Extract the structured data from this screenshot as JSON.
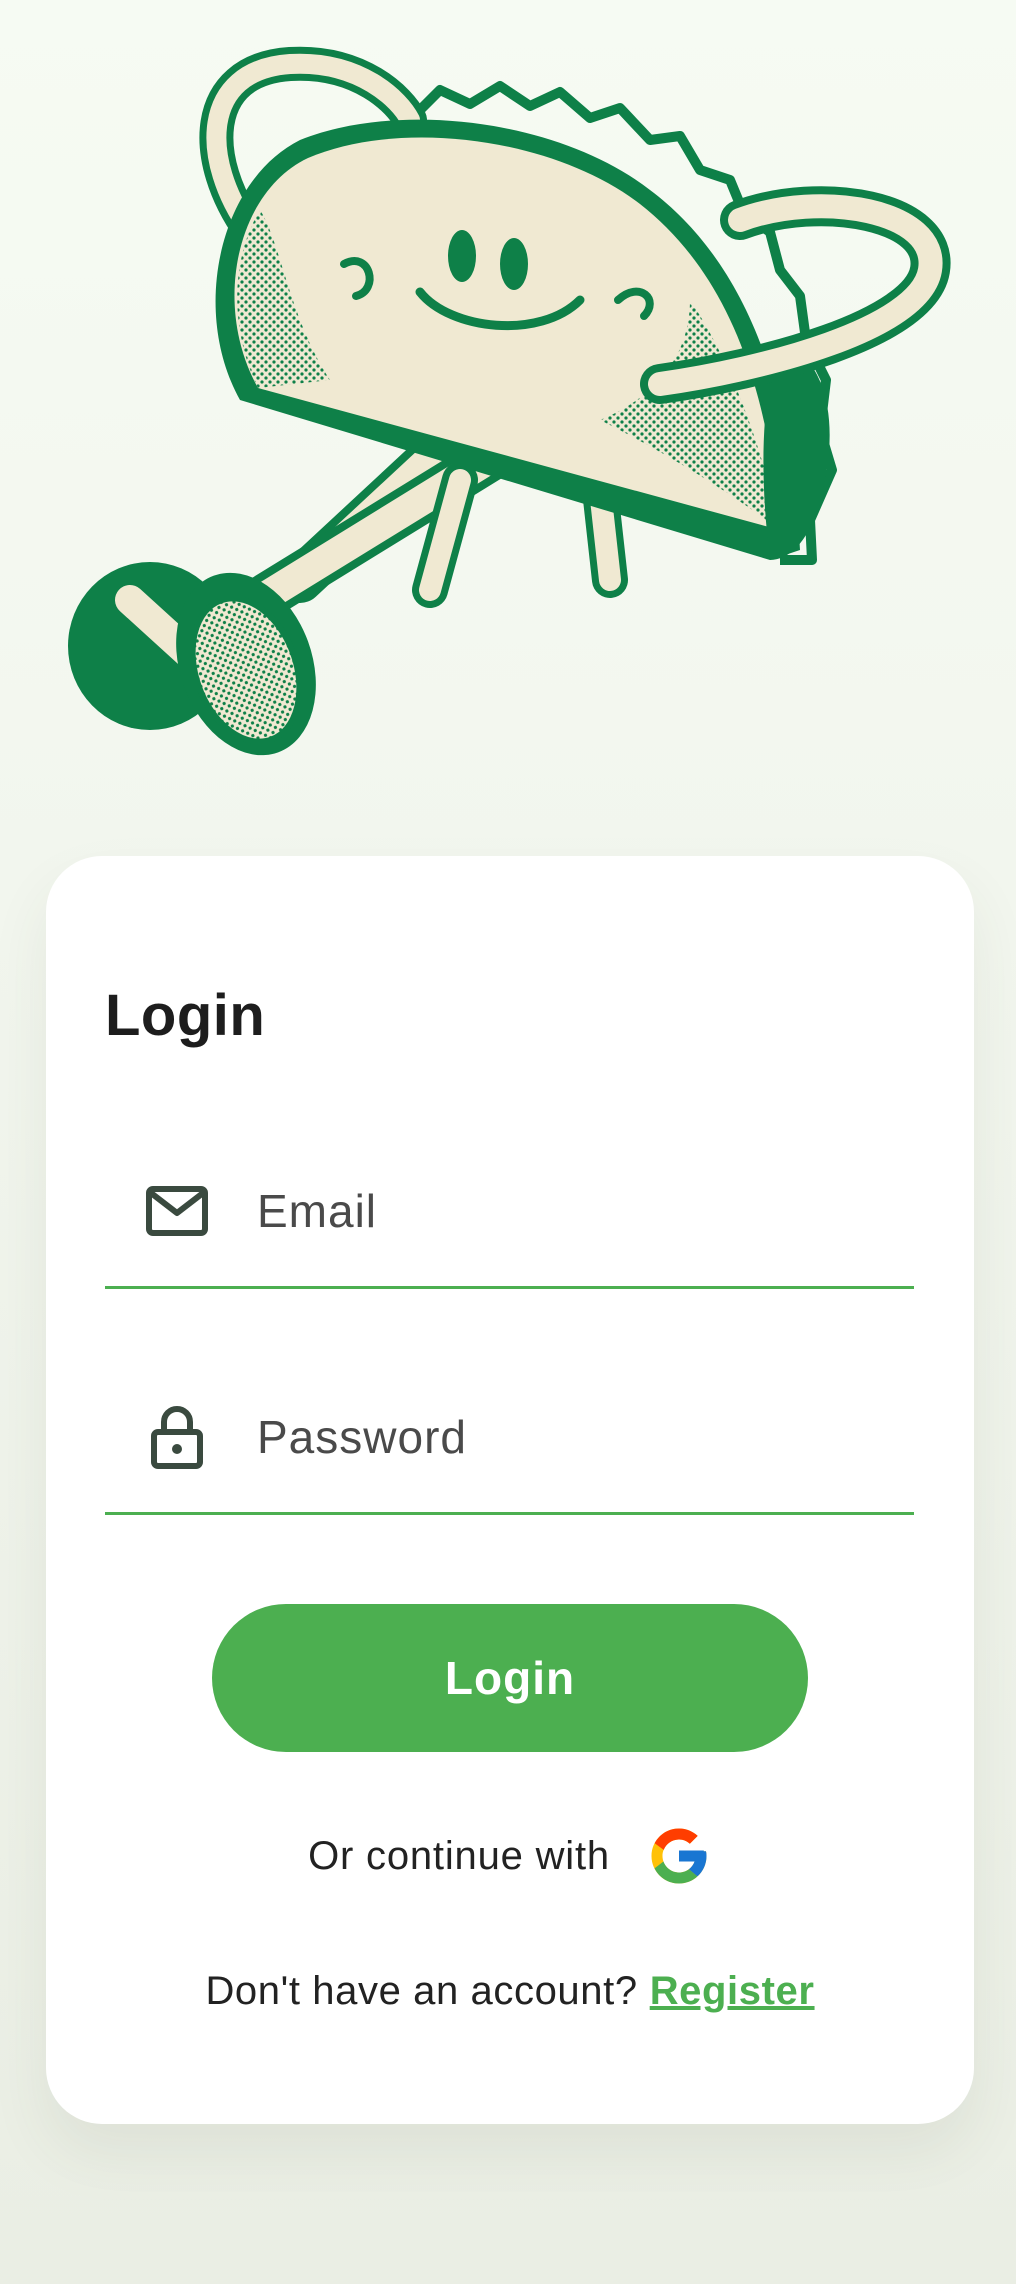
{
  "login": {
    "title": "Login",
    "email": {
      "placeholder": "Email",
      "value": "",
      "icon": "mail-icon"
    },
    "password": {
      "placeholder": "Password",
      "value": "",
      "icon": "lock-icon"
    },
    "button_label": "Login",
    "continue_text": "Or continue with",
    "google_icon": "google-icon",
    "register_prompt": "Don't have an account?",
    "register_link": "Register"
  },
  "colors": {
    "accent": "#4caf50",
    "mascot_dark": "#0e8048",
    "mascot_light": "#f0e9d2",
    "background": "#f6fbf3"
  }
}
